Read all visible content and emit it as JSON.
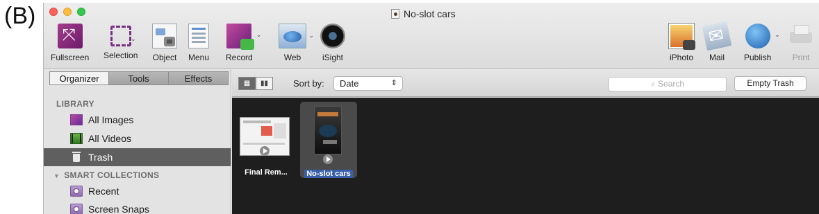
{
  "panel_label": "(B)",
  "window": {
    "title": "No-slot cars",
    "toolbar": {
      "fullscreen": "Fullscreen",
      "selection": "Selection",
      "object": "Object",
      "menu": "Menu",
      "record": "Record",
      "web": "Web",
      "isight": "iSight",
      "iphoto": "iPhoto",
      "mail": "Mail",
      "publish": "Publish",
      "print": "Print"
    }
  },
  "sidebar": {
    "tabs": [
      "Organizer",
      "Tools",
      "Effects"
    ],
    "active_tab": "Organizer",
    "library_header": "LIBRARY",
    "library_items": [
      {
        "label": "All Images",
        "icon": "images-icon"
      },
      {
        "label": "All Videos",
        "icon": "videos-icon"
      },
      {
        "label": "Trash",
        "icon": "trash-icon",
        "selected": true
      }
    ],
    "smart_header": "SMART COLLECTIONS",
    "smart_items": [
      {
        "label": "Recent",
        "icon": "smart-folder-icon"
      },
      {
        "label": "Screen Snaps",
        "icon": "smart-folder-icon"
      }
    ]
  },
  "content": {
    "sort_label": "Sort by:",
    "sort_value": "Date",
    "search_placeholder": "Search",
    "empty_trash": "Empty Trash",
    "items": [
      {
        "label": "Final Rem...",
        "selected": false
      },
      {
        "label": "No-slot cars",
        "selected": true
      }
    ]
  },
  "colors": {
    "selection_highlight": "#3a5faa",
    "sidebar_selected": "#5f5f5f",
    "grid_background": "#1e1e1e"
  }
}
